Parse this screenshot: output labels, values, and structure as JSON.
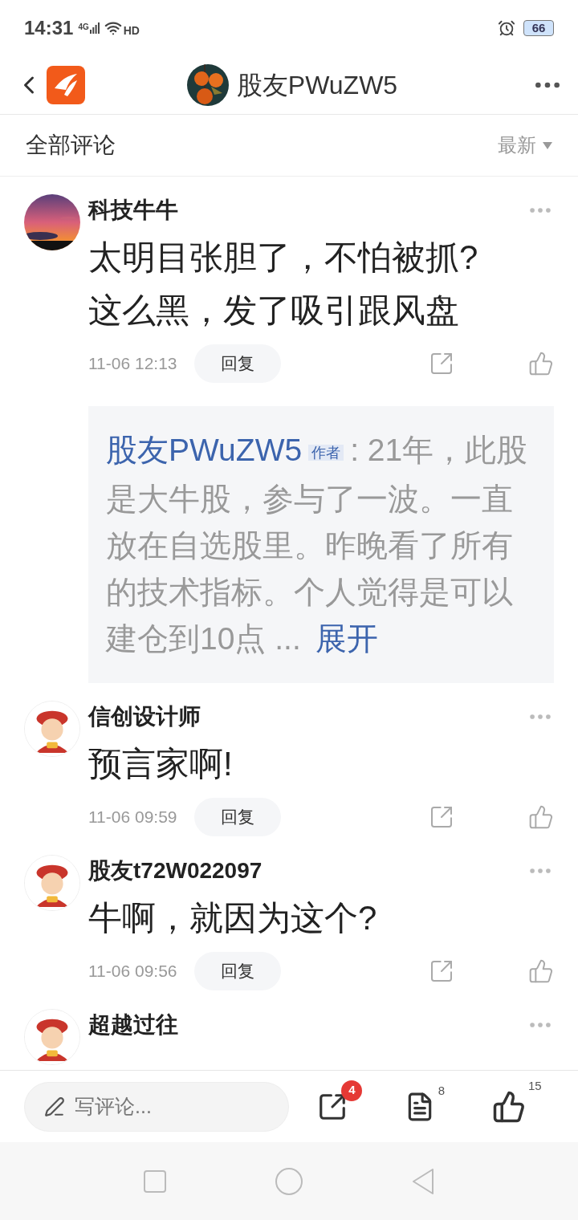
{
  "status_bar": {
    "time": "14:31",
    "network": "4G",
    "hd": "HD",
    "battery": "66"
  },
  "header": {
    "title": "股友PWuZW5"
  },
  "sort_bar": {
    "title": "全部评论",
    "sort": "最新"
  },
  "comments": [
    {
      "name": "科技牛牛",
      "text": "太明目张胆了，不怕被抓?这么黑，发了吸引跟风盘",
      "time": "11-06 12:13",
      "reply_label": "回复",
      "reply": {
        "author": "股友PWuZW5",
        "badge": "作者",
        "text": ": 21年，此股是大牛股，参与了一波。一直放在自选股里。昨晚看了所有的技术指标。个人觉得是可以建仓到10点 ...",
        "expand": "展开"
      }
    },
    {
      "name": "信创设计师",
      "text": "预言家啊!",
      "time": "11-06 09:59",
      "reply_label": "回复"
    },
    {
      "name": "股友t72W022097",
      "text": "牛啊，就因为这个?",
      "time": "11-06 09:56",
      "reply_label": "回复"
    },
    {
      "name": "超越过往"
    }
  ],
  "bottom_bar": {
    "placeholder": "写评论...",
    "share_badge": "4",
    "comments_count": "8",
    "likes_count": "15"
  }
}
